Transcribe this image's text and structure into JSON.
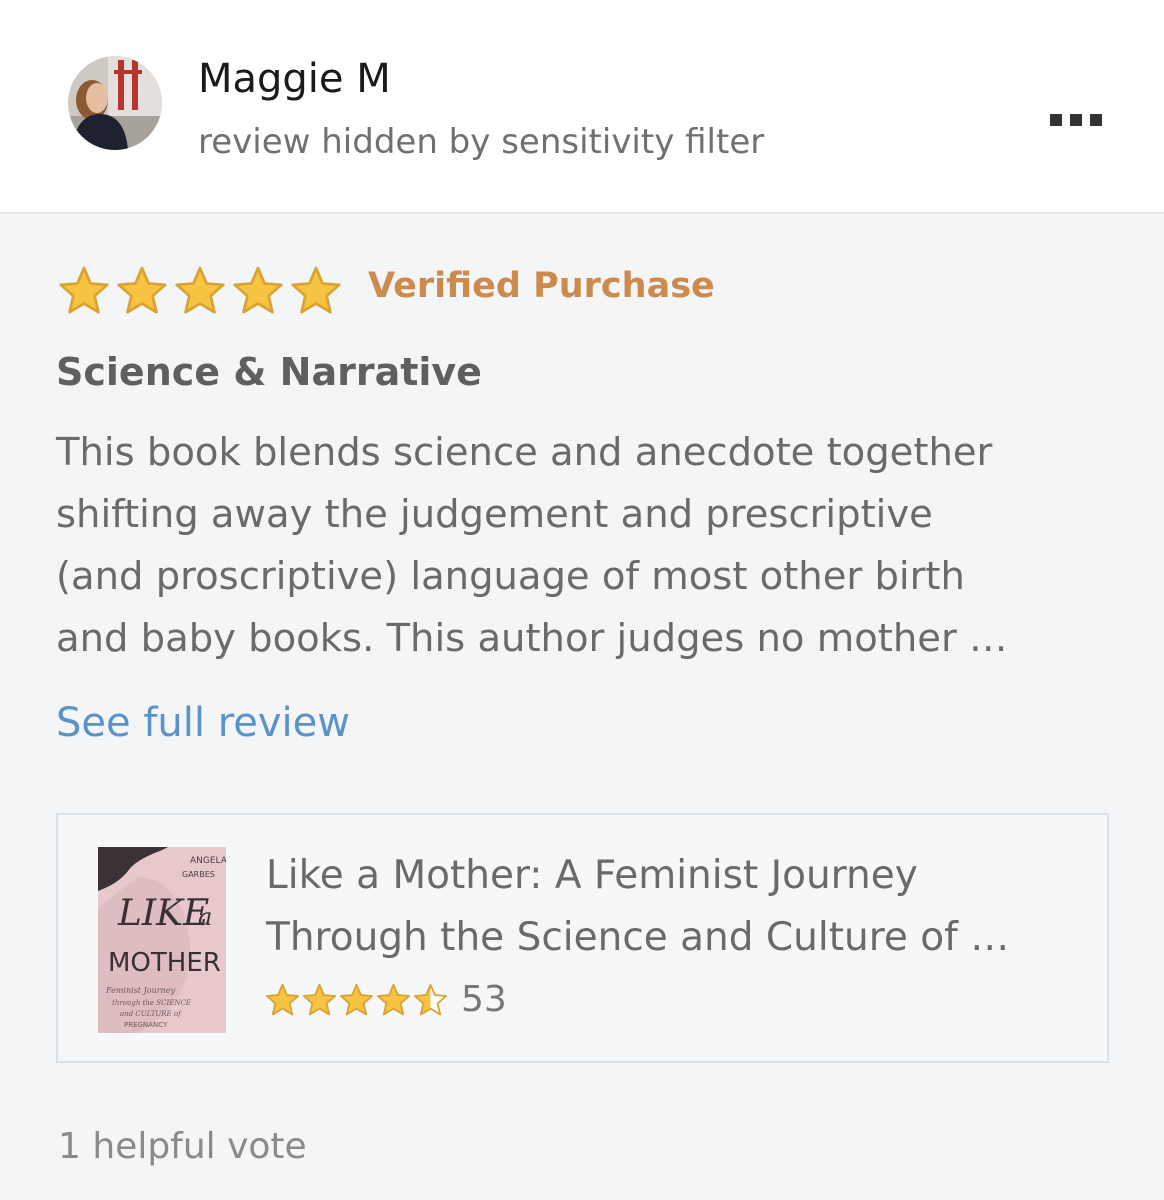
{
  "reviewer": {
    "name": "Maggie M",
    "subtitle": "review hidden by sensitivity filter"
  },
  "review": {
    "rating": 5,
    "rating_max": 5,
    "badge": "Verified Purchase",
    "title": "Science & Narrative",
    "body_lines": [
      "This book blends science and anecdote together",
      "shifting away the judgement and prescriptive",
      "(and proscriptive) language of most other birth",
      "and baby books. This author judges no mother …"
    ],
    "see_full_label": "See full review"
  },
  "product": {
    "title_lines": [
      "Like a Mother: A Feminist Journey",
      "Through the Science and Culture of …"
    ],
    "rating": 4.5,
    "rating_count": "53",
    "cover": {
      "author": "ANGELA GARBES",
      "title_1": "LIKE",
      "title_2": "a",
      "title_3": "MOTHER",
      "subtitle_lines": [
        "Feminist Journey",
        "through the SCIENCE",
        "and CULTURE of",
        "PREGNANCY"
      ]
    }
  },
  "helpful_votes": "1 helpful vote",
  "colors": {
    "accent_link": "#5b93c9",
    "verified": "#cc8a4d",
    "star_fill": "#f6c343",
    "star_stroke": "#d9a232",
    "cover_bg": "#e7c9cc"
  },
  "icons": {
    "more": "more-options-icon",
    "star": "star-icon"
  }
}
